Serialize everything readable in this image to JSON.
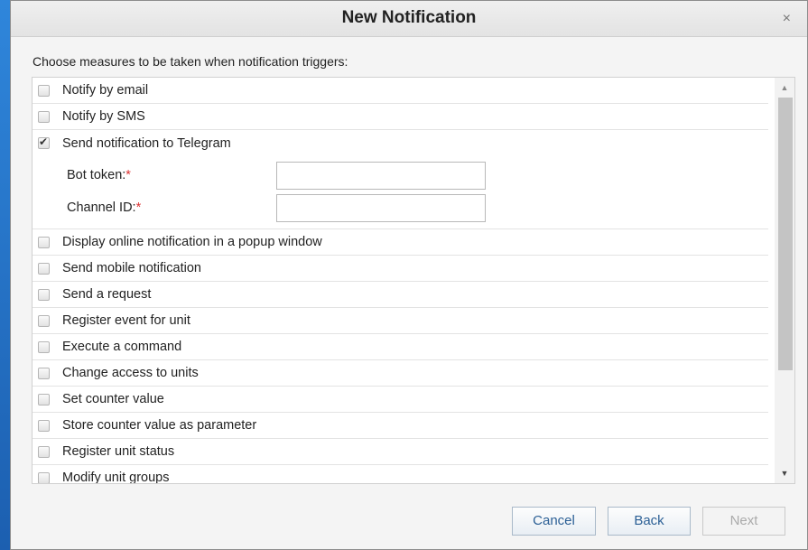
{
  "dialog": {
    "title": "New Notification",
    "close_glyph": "×"
  },
  "instruction": "Choose measures to be taken when notification triggers:",
  "actions": [
    {
      "label": "Notify by email",
      "checked": false
    },
    {
      "label": "Notify by SMS",
      "checked": false
    },
    {
      "label": "Send notification to Telegram",
      "checked": true
    },
    {
      "label": "Display online notification in a popup window",
      "checked": false
    },
    {
      "label": "Send mobile notification",
      "checked": false
    },
    {
      "label": "Send a request",
      "checked": false
    },
    {
      "label": "Register event for unit",
      "checked": false
    },
    {
      "label": "Execute a command",
      "checked": false
    },
    {
      "label": "Change access to units",
      "checked": false
    },
    {
      "label": "Set counter value",
      "checked": false
    },
    {
      "label": "Store counter value as parameter",
      "checked": false
    },
    {
      "label": "Register unit status",
      "checked": false
    },
    {
      "label": "Modify unit groups",
      "checked": false
    }
  ],
  "telegram_fields": {
    "bot_token_label": "Bot token:",
    "bot_token_value": "",
    "channel_id_label": "Channel ID:",
    "channel_id_value": "",
    "required_mark": "*"
  },
  "scrollbar": {
    "up_glyph": "▲",
    "down_glyph": "▼"
  },
  "buttons": {
    "cancel": "Cancel",
    "back": "Back",
    "next": "Next"
  }
}
